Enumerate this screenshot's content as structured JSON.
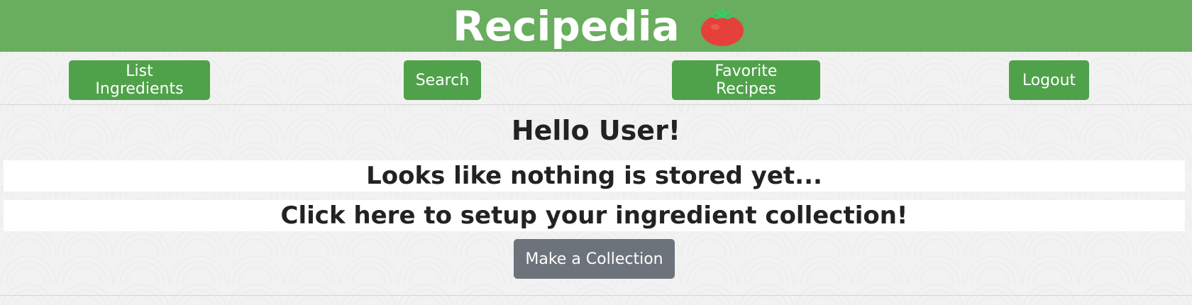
{
  "header": {
    "title": "Recipedia",
    "logo_icon": "tomato-icon",
    "background": "#69ad5e"
  },
  "nav": {
    "list_ingredients": "List Ingredients",
    "search": "Search",
    "favorite_recipes": "Favorite Recipes",
    "logout": "Logout",
    "button_color": "#4fa24a"
  },
  "main": {
    "greeting": "Hello User!",
    "empty_message": "Looks like nothing is stored yet...",
    "setup_prompt": "Click here to setup your ingredient collection!",
    "make_collection": "Make a Collection",
    "make_button_color": "#6c737a"
  }
}
